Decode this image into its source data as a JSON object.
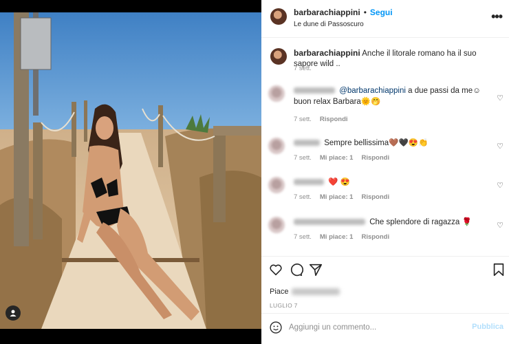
{
  "post": {
    "username": "barbarachiappini",
    "separator": "•",
    "follow_label": "Segui",
    "location": "Le dune di Passoscuro",
    "more_icon": "more-horizontal-icon"
  },
  "caption": {
    "username": "barbarachiappini",
    "text": "Anche il litorale romano ha il suo sapore wild ..",
    "time": "7 sett."
  },
  "comments": [
    {
      "mention": "@barbarachiappini",
      "text": " a due passi da me☺ buon relax Barbara🌞🤭",
      "time": "7 sett.",
      "likes_label": "",
      "reply_label": "Rispondi"
    },
    {
      "mention": "",
      "text": "Sempre bellissima🤎🖤😍👏",
      "time": "7 sett.",
      "likes_label": "Mi piace: 1",
      "reply_label": "Rispondi"
    },
    {
      "mention": "",
      "text": "❤️ 😍",
      "time": "7 sett.",
      "likes_label": "Mi piace: 1",
      "reply_label": "Rispondi"
    },
    {
      "mention": "",
      "text": "Che splendore di ragazza 🌹",
      "time": "7 sett.",
      "likes_label": "Mi piace: 1",
      "reply_label": "Rispondi"
    }
  ],
  "likes": {
    "prefix": "Piace"
  },
  "date": "LUGLIO 7",
  "add_comment": {
    "placeholder": "Aggiungi un commento...",
    "publish_label": "Pubblica"
  },
  "colors": {
    "accent": "#0095f6",
    "publish_disabled": "#b2dffc",
    "muted": "#8e8e8e"
  },
  "icons": [
    "like-icon",
    "comment-icon",
    "share-icon",
    "save-icon",
    "emoji-icon",
    "user-tag-icon"
  ]
}
